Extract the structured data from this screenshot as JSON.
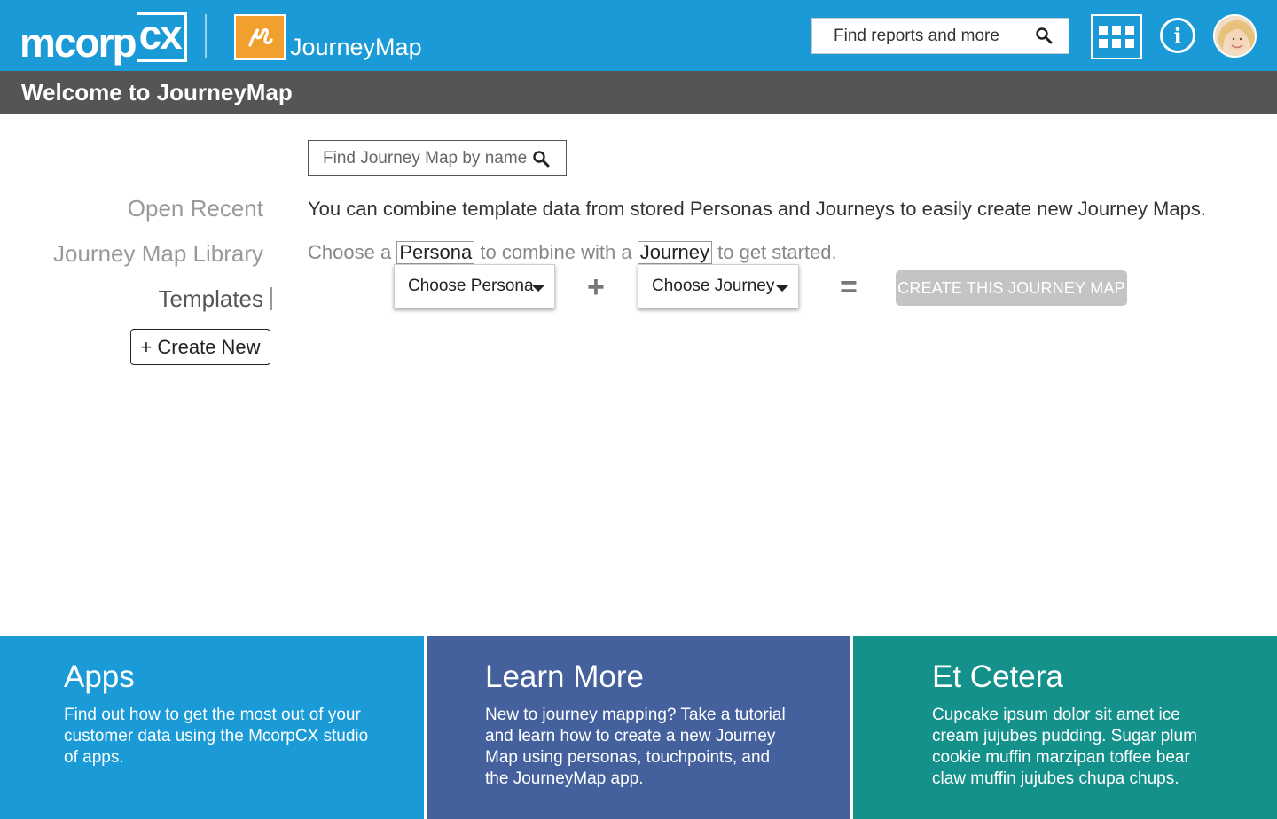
{
  "header": {
    "logo_text": "mcorp",
    "logo_suffix": "cx",
    "app_name": "JourneyMap",
    "search_placeholder": "Find reports and more",
    "icons": [
      "journeymap-app-icon",
      "search-icon",
      "app-grid-icon",
      "info-icon",
      "user-avatar"
    ],
    "colors": {
      "primary": "#1a9ad6",
      "app_icon": "#f2a02d"
    }
  },
  "subheader": {
    "title": "Welcome to JourneyMap",
    "color": "#555555"
  },
  "sidebar": {
    "items": [
      {
        "label": "Open Recent"
      },
      {
        "label": "Journey Map Library"
      },
      {
        "label": "Templates",
        "active": true
      }
    ],
    "create_label": "+ Create New"
  },
  "main": {
    "search_placeholder": "Find Journey Map by name",
    "intro": "You can combine template data from stored Personas and Journeys to easily create new Journey Maps.",
    "choose_prefix": "Choose a",
    "persona_word": "Persona",
    "combine_text": "to combine with a",
    "journey_word": "Journey",
    "started_text": "to get started.",
    "persona_dropdown": "Choose Persona",
    "journey_dropdown": "Choose Journey",
    "plus": "+",
    "equals": "=",
    "create_map_label": "CREATE THIS JOURNEY MAP"
  },
  "footer": {
    "panels": [
      {
        "title": "Apps",
        "text": "Find out how to get the most out of your customer data using the McorpCX studio of apps.",
        "color": "#1a9ad6"
      },
      {
        "title": "Learn More",
        "text": "New to journey mapping? Take a tutorial and learn how to create a new Journey Map using personas, touchpoints, and the JourneyMap app.",
        "color": "#44619e"
      },
      {
        "title": "Et Cetera",
        "text": "Cupcake ipsum dolor sit amet ice cream jujubes pudding. Sugar plum cookie muffin marzipan toffee bear claw muffin jujubes chupa chups.",
        "color": "#14918b"
      }
    ]
  }
}
